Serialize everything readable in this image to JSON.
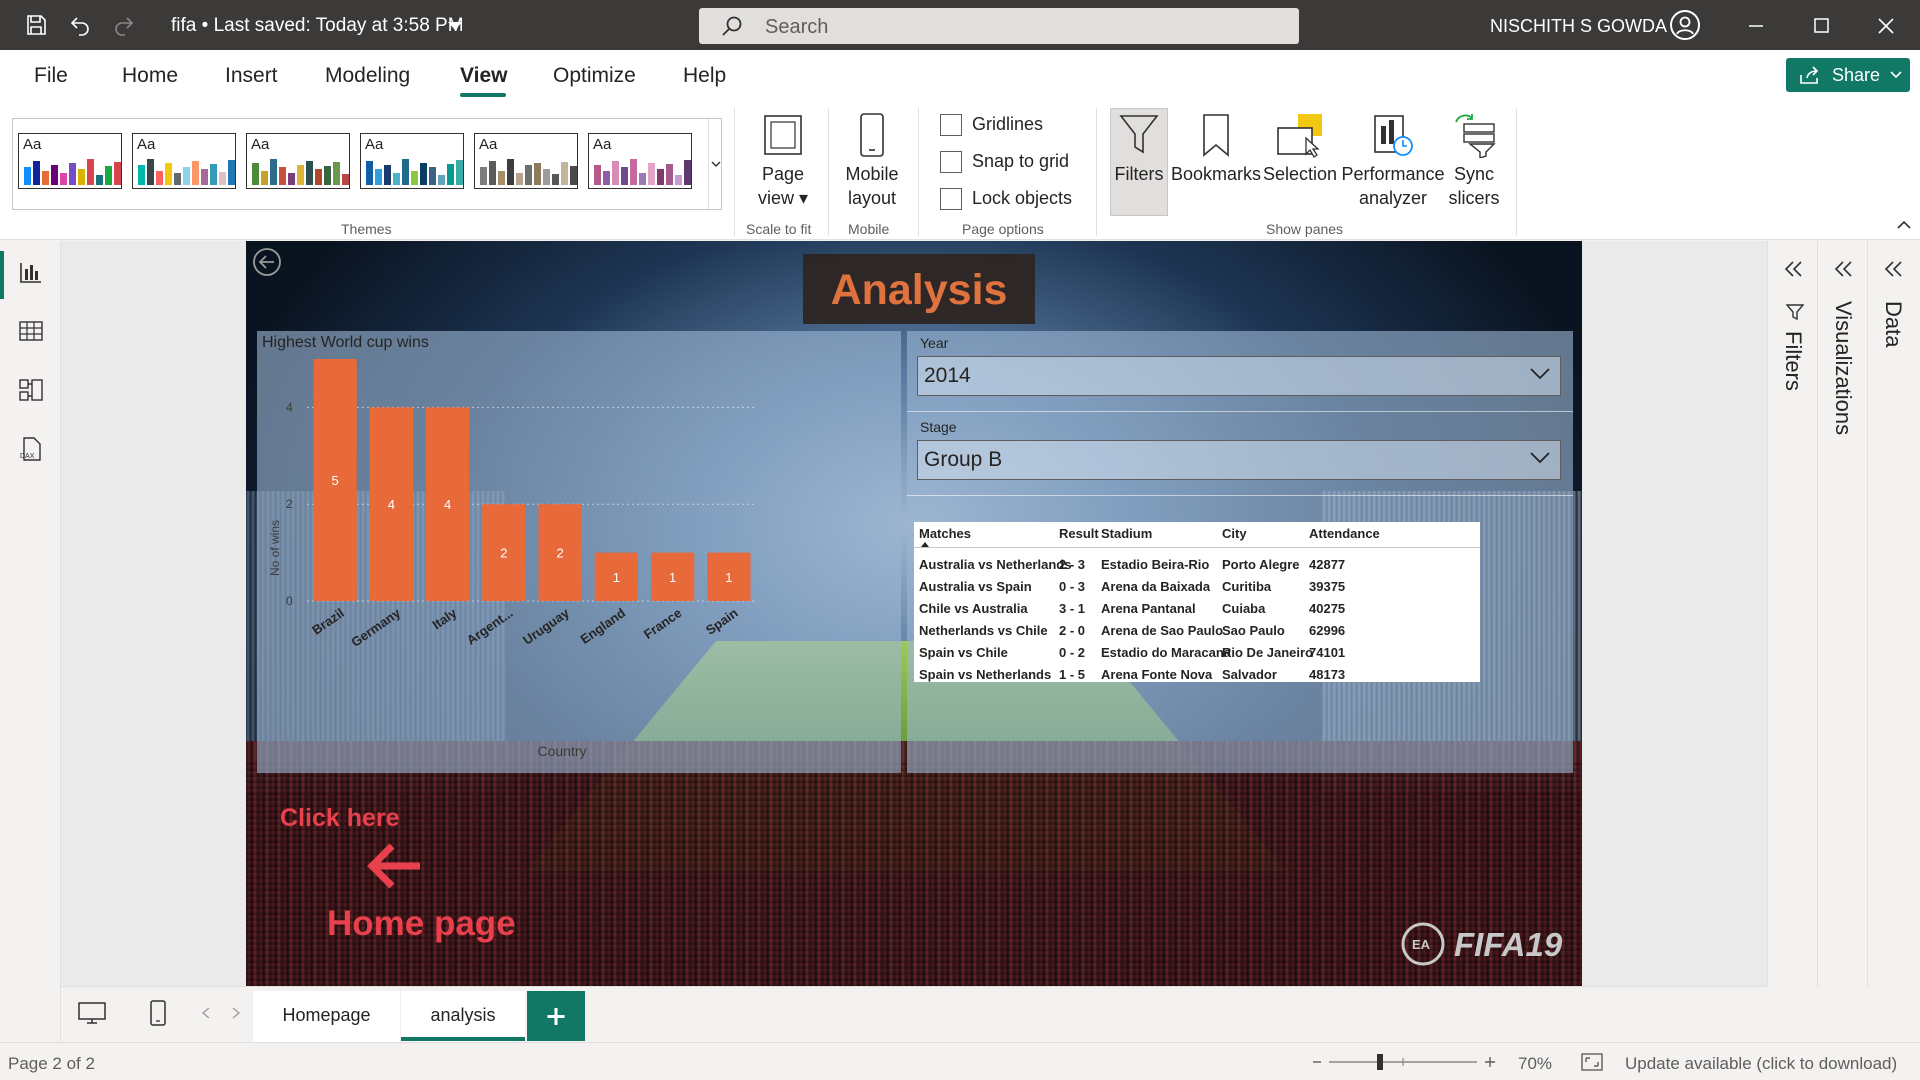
{
  "app": {
    "file_name": "fifa",
    "saved_status": "Last saved: Today at 3:58 PM",
    "search_placeholder": "Search",
    "user_name": "NISCHITH S GOWDA"
  },
  "ribbon_tabs": [
    "File",
    "Home",
    "Insert",
    "Modeling",
    "View",
    "Optimize",
    "Help"
  ],
  "active_tab": "View",
  "share_label": "Share",
  "ribbon": {
    "themes_label": "Themes",
    "page_view": "Page view",
    "scale_to_fit": "Scale to fit",
    "mobile_layout": "Mobile layout",
    "mobile": "Mobile",
    "gridlines": "Gridlines",
    "snap_to_grid": "Snap to grid",
    "lock_objects": "Lock objects",
    "page_options": "Page options",
    "filters": "Filters",
    "bookmarks": "Bookmarks",
    "selection": "Selection",
    "performance_analyzer": "Performance analyzer",
    "sync_slicers": "Sync slicers",
    "show_panes": "Show panes",
    "theme_swatch_text": "Aa"
  },
  "report": {
    "title": "Analysis",
    "click_here": "Click here",
    "home_page": "Home page",
    "logo_text": "FIFA19",
    "year_label": "Year",
    "year_value": "2014",
    "stage_label": "Stage",
    "stage_value": "Group B"
  },
  "chart_data": {
    "type": "bar",
    "title": "Highest World cup wins",
    "xlabel": "Country",
    "ylabel": "No of wins",
    "categories": [
      "Brazil",
      "Germany",
      "Italy",
      "Argent...",
      "Uruguay",
      "England",
      "France",
      "Spain"
    ],
    "values": [
      5,
      4,
      4,
      2,
      2,
      1,
      1,
      1
    ],
    "y_ticks": [
      0,
      2,
      4
    ],
    "ylim": [
      0,
      5
    ],
    "color": "#e8693a"
  },
  "table": {
    "columns": [
      "Matches",
      "Result",
      "Stadium",
      "City",
      "Attendance"
    ],
    "rows": [
      [
        "Australia vs Netherlands",
        "2 - 3",
        "Estadio Beira-Rio",
        "Porto Alegre",
        "42877"
      ],
      [
        "Australia vs Spain",
        "0 - 3",
        "Arena da Baixada",
        "Curitiba",
        "39375"
      ],
      [
        "Chile vs Australia",
        "3 - 1",
        "Arena Pantanal",
        "Cuiaba",
        "40275"
      ],
      [
        "Netherlands vs Chile",
        "2 - 0",
        "Arena de Sao Paulo",
        "Sao Paulo",
        "62996"
      ],
      [
        "Spain vs Chile",
        "0 - 2",
        "Estadio do Maracana",
        "Rio De Janeiro",
        "74101"
      ],
      [
        "Spain vs Netherlands",
        "1 - 5",
        "Arena Fonte Nova",
        "Salvador",
        "48173"
      ]
    ]
  },
  "panes": [
    "Filters",
    "Visualizations",
    "Data"
  ],
  "page_tabs": [
    "Homepage",
    "analysis"
  ],
  "active_page": "analysis",
  "status": {
    "page_info": "Page 2 of 2",
    "zoom": "70%",
    "update": "Update available (click to download)"
  },
  "colors": {
    "accent": "#117865",
    "title_orange": "#e8743b",
    "home_red": "#e8414d"
  }
}
